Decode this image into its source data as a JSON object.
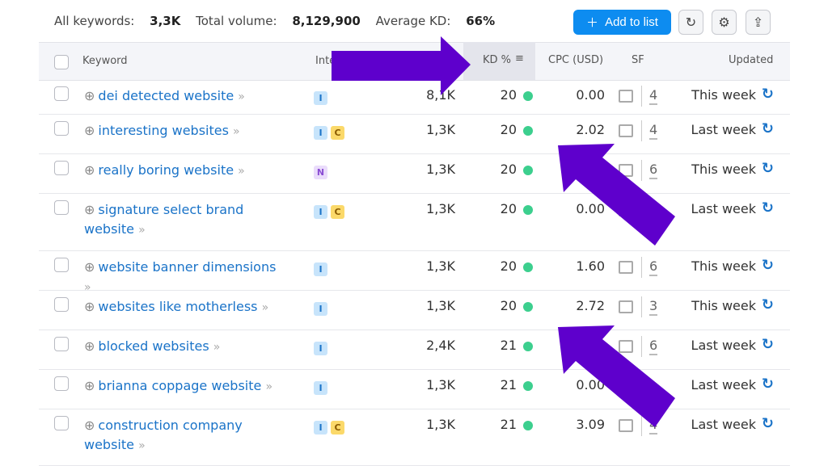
{
  "summary": {
    "all_label": "All keywords:",
    "all": "3,3K",
    "vol_label": "Total volume:",
    "vol": "8,129,900",
    "kd_label": "Average KD:",
    "kd": "66%"
  },
  "toolbar": {
    "add": "Add to list",
    "refresh_icon": "refresh-icon",
    "settings_icon": "gear-icon",
    "export_icon": "upload-icon"
  },
  "columns": {
    "keyword": "Keyword",
    "intent": "Inte",
    "kd": "KD %",
    "cpc": "CPC (USD)",
    "sf": "SF",
    "updated": "Updated"
  },
  "colors": {
    "accent": "#0d8cf0",
    "arrow": "#5e00cc",
    "kd_dot": "#3ccf8e"
  },
  "rows": [
    {
      "keyword": "dei detected website",
      "intent": [
        "I"
      ],
      "volume": "8,1K",
      "kd": "20",
      "cpc": "0.00",
      "sf": "4",
      "updated": "This week"
    },
    {
      "keyword": "interesting websites",
      "intent": [
        "I",
        "C"
      ],
      "volume": "1,3K",
      "kd": "20",
      "cpc": "2.02",
      "sf": "4",
      "updated": "Last week"
    },
    {
      "keyword": "really boring website",
      "intent": [
        "N"
      ],
      "volume": "1,3K",
      "kd": "20",
      "cpc": "",
      "sf": "6",
      "updated": "This week"
    },
    {
      "keyword": "signature select brand website",
      "intent": [
        "I",
        "C"
      ],
      "volume": "1,3K",
      "kd": "20",
      "cpc": "0.00",
      "sf": "",
      "updated": "Last week"
    },
    {
      "keyword": "website banner dimensions",
      "intent": [
        "I"
      ],
      "volume": "1,3K",
      "kd": "20",
      "cpc": "1.60",
      "sf": "6",
      "updated": "This week"
    },
    {
      "keyword": "websites like motherless",
      "intent": [
        "I"
      ],
      "volume": "1,3K",
      "kd": "20",
      "cpc": "2.72",
      "sf": "3",
      "updated": "This week"
    },
    {
      "keyword": "blocked websites",
      "intent": [
        "I"
      ],
      "volume": "2,4K",
      "kd": "21",
      "cpc": "",
      "sf": "6",
      "updated": "Last week"
    },
    {
      "keyword": "brianna coppage website",
      "intent": [
        "I"
      ],
      "volume": "1,3K",
      "kd": "21",
      "cpc": "0.00",
      "sf": "",
      "updated": "Last week"
    },
    {
      "keyword": "construction company website",
      "intent": [
        "I",
        "C"
      ],
      "volume": "1,3K",
      "kd": "21",
      "cpc": "3.09",
      "sf": "4",
      "updated": "Last week"
    }
  ]
}
